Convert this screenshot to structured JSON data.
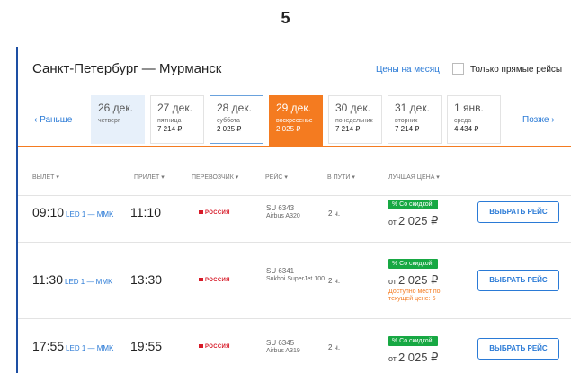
{
  "step_number": "5",
  "header": {
    "route_title": "Санкт-Петербург — Мурманск",
    "month_prices_link": "Цены на месяц",
    "direct_only_label": "Только прямые рейсы"
  },
  "date_nav": {
    "prev_label": "‹ Раньше",
    "next_label": "Позже ›",
    "dates": [
      {
        "date": "26 дек.",
        "weekday": "четверг",
        "price": ""
      },
      {
        "date": "27 дек.",
        "weekday": "пятница",
        "price": "7 214 ₽"
      },
      {
        "date": "28 дек.",
        "weekday": "суббота",
        "price": "2 025 ₽"
      },
      {
        "date": "29 дек.",
        "weekday": "воскресенье",
        "price": "2 025 ₽"
      },
      {
        "date": "30 дек.",
        "weekday": "понедельник",
        "price": "7 214 ₽"
      },
      {
        "date": "31 дек.",
        "weekday": "вторник",
        "price": "7 214 ₽"
      },
      {
        "date": "1 янв.",
        "weekday": "среда",
        "price": "4 434 ₽"
      }
    ],
    "selected_index": 3
  },
  "columns": {
    "departure": "ВЫЛЕТ ▾",
    "arrival": "ПРИЛЕТ ▾",
    "carrier": "ПЕРЕВОЗЧИК ▾",
    "flight": "РЕЙС ▾",
    "duration": "В ПУТИ ▾",
    "best_price": "ЛУЧШАЯ ЦЕНА ▾"
  },
  "flights": [
    {
      "dep_time": "09:10",
      "route": "LED 1 — MMK",
      "arr_time": "11:10",
      "carrier": "РОССИЯ",
      "flight_no": "SU 6343",
      "aircraft": "Airbus A320",
      "duration": "2 ч.",
      "badge": "% Со скидкой!",
      "price_prefix": "от",
      "price": "2 025 ₽",
      "note": "",
      "button": "ВЫБРАТЬ РЕЙС"
    },
    {
      "dep_time": "11:30",
      "route": "LED 1 — MMK",
      "arr_time": "13:30",
      "carrier": "РОССИЯ",
      "flight_no": "SU 6341",
      "aircraft": "Sukhoi SuperJet 100",
      "duration": "2 ч.",
      "badge": "% Со скидкой!",
      "price_prefix": "от",
      "price": "2 025 ₽",
      "note": "Доступно мест по текущей цене: 5",
      "button": "ВЫБРАТЬ РЕЙС"
    },
    {
      "dep_time": "17:55",
      "route": "LED 1 — MMK",
      "arr_time": "19:55",
      "carrier": "РОССИЯ",
      "flight_no": "SU 6345",
      "aircraft": "Airbus A319",
      "duration": "2 ч.",
      "badge": "% Со скидкой!",
      "price_prefix": "от",
      "price": "2 025 ₽",
      "note": "",
      "button": "ВЫБРАТЬ РЕЙС"
    }
  ],
  "colors": {
    "accent_orange": "#f47b20",
    "link_blue": "#2a7ad6",
    "frame_blue": "#1d4fa3",
    "discount_green": "#17a843",
    "carrier_red": "#d71a28"
  }
}
